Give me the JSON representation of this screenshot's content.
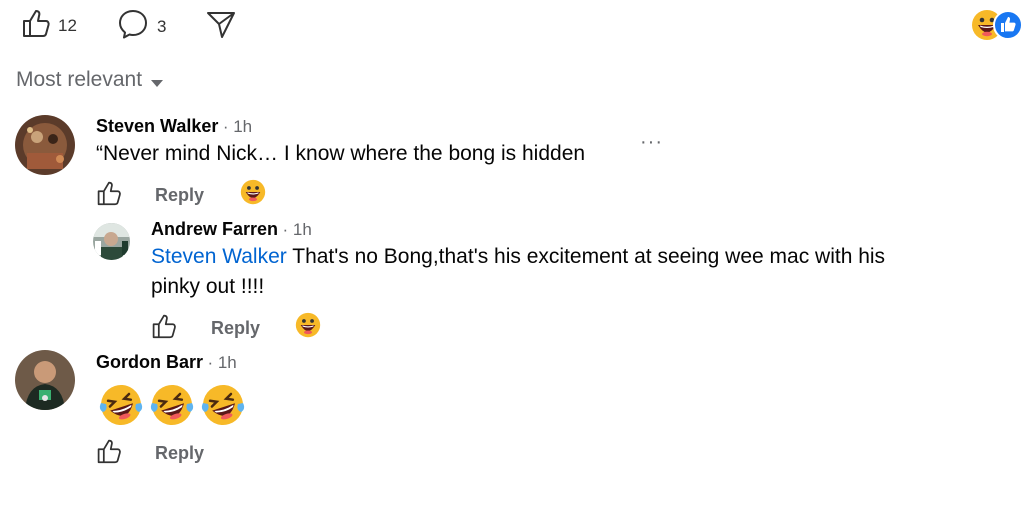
{
  "top_bar": {
    "like_count": "12",
    "comment_count": "3"
  },
  "sort": {
    "label": "Most relevant"
  },
  "comments": [
    {
      "author": "Steven Walker",
      "time": "· 1h",
      "text": "“Never mind Nick… I know where the bong is hidden",
      "reply_label": "Reply"
    },
    {
      "author": "Andrew Farren",
      "time": "· 1h",
      "mention": "Steven Walker",
      "text_line1": " That's no Bong,that's his excitement at seeing wee mac with his",
      "text_line2": "pinky out !!!!",
      "reply_label": "Reply"
    },
    {
      "author": "Gordon Barr",
      "time": "· 1h",
      "reply_label": "Reply"
    }
  ],
  "more_label": "···",
  "icons": [
    "like-icon",
    "comment-icon",
    "share-icon",
    "grin-emoji-icon",
    "like-reaction-icon",
    "chevron-down-icon",
    "more-options-icon",
    "laughing-crying-emoji-icon"
  ],
  "colors": {
    "link": "#0064d1",
    "muted": "#65676b",
    "reaction_blue": "#1877f2",
    "emoji_yellow": "#f7b928"
  }
}
